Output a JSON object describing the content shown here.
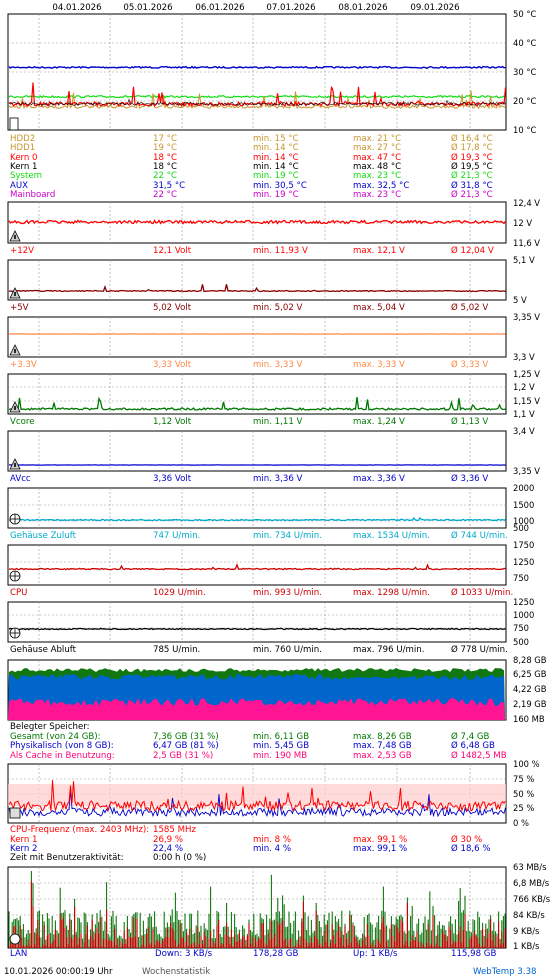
{
  "dates": [
    "04.01.2026",
    "05.01.2026",
    "06.01.2026",
    "07.01.2026",
    "08.01.2026",
    "09.01.2026"
  ],
  "temperature": {
    "axis_labels": [
      "50 °C",
      "40 °C",
      "30 °C",
      "20 °C",
      "10 °C"
    ],
    "rows": [
      {
        "name": "HDD2",
        "cur": "17 °C",
        "min": "min. 15 °C",
        "max": "max. 21 °C",
        "avg": "Ø 16,4 °C",
        "color": "#c8962d"
      },
      {
        "name": "HDD1",
        "cur": "19 °C",
        "min": "min. 14 °C",
        "max": "max. 27 °C",
        "avg": "Ø 17,8 °C",
        "color": "#c8962d"
      },
      {
        "name": "Kern 0",
        "cur": "18 °C",
        "min": "min. 14 °C",
        "max": "max. 47 °C",
        "avg": "Ø 19,3 °C",
        "color": "#ff0000"
      },
      {
        "name": "Kern 1",
        "cur": "18 °C",
        "min": "min. 14 °C",
        "max": "max. 48 °C",
        "avg": "Ø 19,5 °C",
        "color": "#000000"
      },
      {
        "name": "System",
        "cur": "22 °C",
        "min": "min. 19 °C",
        "max": "max. 23 °C",
        "avg": "Ø 21,3 °C",
        "color": "#11dd11"
      },
      {
        "name": "AUX",
        "cur": "31,5 °C",
        "min": "min. 30,5 °C",
        "max": "max. 32,5 °C",
        "avg": "Ø 31,8 °C",
        "color": "#0000cc"
      },
      {
        "name": "Mainboard",
        "cur": "22 °C",
        "min": "min. 19 °C",
        "max": "max. 23 °C",
        "avg": "Ø 21,3 °C",
        "color": "#cc00cc"
      }
    ]
  },
  "voltages": [
    {
      "id": "v12",
      "axis_labels": [
        "12,4 V",
        "12 V",
        "11,6 V"
      ],
      "row": {
        "name": "+12V",
        "cur": "12,1 Volt",
        "min": "min. 11,93 V",
        "max": "max. 12,1 V",
        "avg": "Ø 12,04 V",
        "color": "#ff0000"
      }
    },
    {
      "id": "v5",
      "axis_labels": [
        "5,1 V",
        "5 V"
      ],
      "row": {
        "name": "+5V",
        "cur": "5,02 Volt",
        "min": "min. 5,02 V",
        "max": "max. 5,04 V",
        "avg": "Ø 5,02 V",
        "color": "#880000"
      }
    },
    {
      "id": "v33",
      "axis_labels": [
        "3,35 V",
        "3,3 V"
      ],
      "row": {
        "name": "+3.3V",
        "cur": "3,33 Volt",
        "min": "min. 3,33 V",
        "max": "max. 3,33 V",
        "avg": "Ø 3,33 V",
        "color": "#ff8844"
      }
    },
    {
      "id": "vcore",
      "axis_labels": [
        "1,25 V",
        "1,2 V",
        "1,15 V",
        "1,1 V"
      ],
      "row": {
        "name": "Vcore",
        "cur": "1,12 Volt",
        "min": "min. 1,11 V",
        "max": "max. 1,24 V",
        "avg": "Ø 1,13 V",
        "color": "#007700"
      }
    },
    {
      "id": "avcc",
      "axis_labels": [
        "3,4 V",
        "3,35 V"
      ],
      "row": {
        "name": "AVcc",
        "cur": "3,36 Volt",
        "min": "min. 3,36 V",
        "max": "max. 3,36 V",
        "avg": "Ø 3,36 V",
        "color": "#0000cc"
      }
    }
  ],
  "fans": [
    {
      "id": "fan_in",
      "axis_labels": [
        "2000",
        "1500",
        "1000",
        "500"
      ],
      "row": {
        "name": "Gehäuse Zuluft",
        "cur": "747 U/min.",
        "min": "min. 734 U/min.",
        "max": "max. 1534 U/min.",
        "avg": "Ø 744 U/min.",
        "color": "#00aacc"
      }
    },
    {
      "id": "fan_cpu",
      "axis_labels": [
        "1750",
        "1250",
        "750"
      ],
      "row": {
        "name": "CPU",
        "cur": "1029 U/min.",
        "min": "min. 993 U/min.",
        "max": "max. 1298 U/min.",
        "avg": "Ø 1033 U/min.",
        "color": "#cc0000"
      }
    },
    {
      "id": "fan_out",
      "axis_labels": [
        "1250",
        "1000",
        "750",
        "500"
      ],
      "row": {
        "name": "Gehäuse Abluft",
        "cur": "785 U/min.",
        "min": "min. 760 U/min.",
        "max": "max. 796 U/min.",
        "avg": "Ø 778 U/min.",
        "color": "#000000"
      }
    }
  ],
  "memory": {
    "axis_labels": [
      "8,28 GB",
      "6,25 GB",
      "4,22 GB",
      "2,19 GB",
      "160 MB"
    ],
    "title": "Belegter Speicher:",
    "rows": [
      {
        "name": "Gesamt (von 24 GB):",
        "cur": "7,36 GB (31 %)",
        "min": "min. 6,11 GB",
        "max": "max. 8,26 GB",
        "avg": "Ø 7,4 GB",
        "color": "#007700"
      },
      {
        "name": "Physikalisch (von 8 GB):",
        "cur": "6,47 GB (81 %)",
        "min": "min. 5,45 GB",
        "max": "max. 7,48 GB",
        "avg": "Ø 6,48 GB",
        "color": "#0000cc"
      },
      {
        "name": "Als Cache in Benutzung:",
        "cur": "2,5 GB (31 %)",
        "min": "min. 190 MB",
        "max": "max. 2,53 GB",
        "avg": "Ø 1482,5 MB",
        "color": "#ff0077"
      }
    ]
  },
  "cpu": {
    "axis_labels": [
      "100 %",
      "75 %",
      "50 %",
      "25 %",
      "0 %"
    ],
    "freq_label": "CPU-Frequenz (max. 2403 MHz):",
    "freq_value": "1585 MHz",
    "rows": [
      {
        "name": "Kern 1",
        "cur": "26,9 %",
        "min": "min. 8 %",
        "max": "max. 99,1 %",
        "avg": "Ø 30 %",
        "color": "#ff0000"
      },
      {
        "name": "Kern 2",
        "cur": "22,4 %",
        "min": "min. 4 %",
        "max": "max. 99,1 %",
        "avg": "Ø 18,6 %",
        "color": "#0000cc"
      }
    ],
    "activity_label": "Zeit mit Benutzeraktivität:",
    "activity_value": "0:00 h (0 %)"
  },
  "lan": {
    "axis_labels": [
      "63 MB/s",
      "6,8 MB/s",
      "766 KB/s",
      "84 KB/s",
      "9 KB/s",
      "1 KB/s"
    ],
    "name": "LAN",
    "down": "Down: 3 KB/s",
    "down_total": "178,28 GB",
    "up": "Up: 1 KB/s",
    "up_total": "115,98 GB"
  },
  "footer": {
    "timestamp": "10.01.2026 00:00:19 Uhr",
    "mode": "Wochenstatistik",
    "brand": "WebTemp 3.38"
  },
  "chart_data": [
    {
      "type": "line",
      "title": "",
      "ylim": [
        10,
        50
      ],
      "x": [
        "04.01.2026",
        "05.01.2026",
        "06.01.2026",
        "07.01.2026",
        "08.01.2026",
        "09.01.2026"
      ],
      "series": [
        {
          "name": "HDD2",
          "values": [
            16,
            16,
            17,
            16,
            16,
            17
          ]
        },
        {
          "name": "HDD1",
          "values": [
            18,
            17,
            19,
            18,
            17,
            19
          ]
        },
        {
          "name": "Kern 0",
          "values": [
            19,
            20,
            19,
            20,
            19,
            18
          ]
        },
        {
          "name": "Kern 1",
          "values": [
            19,
            20,
            19,
            20,
            19,
            18
          ]
        },
        {
          "name": "System",
          "values": [
            21,
            21,
            22,
            21,
            21,
            22
          ]
        },
        {
          "name": "AUX",
          "values": [
            31.5,
            31.8,
            32,
            31.6,
            32,
            31.5
          ]
        },
        {
          "name": "Mainboard",
          "values": [
            21,
            21,
            22,
            21,
            21,
            22
          ]
        }
      ]
    },
    {
      "type": "line",
      "title": "",
      "ylim": [
        11.6,
        12.4
      ],
      "series": [
        {
          "name": "+12V",
          "values": [
            12.04,
            12.04,
            12.03,
            12.04,
            12.05,
            12.1
          ]
        }
      ]
    },
    {
      "type": "line",
      "title": "",
      "ylim": [
        5.0,
        5.1
      ],
      "series": [
        {
          "name": "+5V",
          "values": [
            5.02,
            5.02,
            5.02,
            5.02,
            5.02,
            5.02
          ]
        }
      ]
    },
    {
      "type": "line",
      "title": "",
      "ylim": [
        3.3,
        3.35
      ],
      "series": [
        {
          "name": "+3.3V",
          "values": [
            3.33,
            3.33,
            3.33,
            3.33,
            3.33,
            3.33
          ]
        }
      ]
    },
    {
      "type": "line",
      "title": "",
      "ylim": [
        1.1,
        1.25
      ],
      "series": [
        {
          "name": "Vcore",
          "values": [
            1.13,
            1.13,
            1.13,
            1.13,
            1.13,
            1.12
          ]
        }
      ]
    },
    {
      "type": "line",
      "title": "",
      "ylim": [
        3.35,
        3.4
      ],
      "series": [
        {
          "name": "AVcc",
          "values": [
            3.36,
            3.36,
            3.36,
            3.36,
            3.36,
            3.36
          ]
        }
      ]
    },
    {
      "type": "line",
      "title": "",
      "ylim": [
        500,
        2000
      ],
      "series": [
        {
          "name": "Gehäuse Zuluft",
          "values": [
            744,
            744,
            744,
            744,
            744,
            747
          ]
        }
      ]
    },
    {
      "type": "line",
      "title": "",
      "ylim": [
        750,
        1750
      ],
      "series": [
        {
          "name": "CPU",
          "values": [
            1033,
            1030,
            1035,
            1033,
            1032,
            1029
          ]
        }
      ]
    },
    {
      "type": "line",
      "title": "",
      "ylim": [
        500,
        1250
      ],
      "series": [
        {
          "name": "Gehäuse Abluft",
          "values": [
            778,
            778,
            778,
            778,
            778,
            785
          ]
        }
      ]
    },
    {
      "type": "area",
      "title": "",
      "ylim": [
        "160 MB",
        "8,28 GB"
      ],
      "series": [
        {
          "name": "Gesamt (von 24 GB):",
          "values": [
            7.4,
            7.4,
            7.3,
            7.4,
            7.5,
            7.36
          ]
        },
        {
          "name": "Physikalisch (von 8 GB):",
          "values": [
            6.5,
            6.4,
            6.5,
            6.5,
            6.5,
            6.47
          ]
        },
        {
          "name": "Als Cache in Benutzung:",
          "values": [
            1.5,
            1.4,
            1.5,
            1.5,
            1.5,
            2.5
          ]
        }
      ]
    },
    {
      "type": "line",
      "title": "",
      "ylim": [
        0,
        100
      ],
      "series": [
        {
          "name": "Kern 1",
          "values": [
            30,
            30,
            30,
            30,
            30,
            26.9
          ]
        },
        {
          "name": "Kern 2",
          "values": [
            18.6,
            18.6,
            18.6,
            18.6,
            18.6,
            22.4
          ]
        }
      ]
    },
    {
      "type": "bar",
      "title": "",
      "series": [
        {
          "name": "LAN",
          "values": [
            84,
            766,
            84,
            766,
            84,
            9
          ]
        }
      ]
    }
  ]
}
